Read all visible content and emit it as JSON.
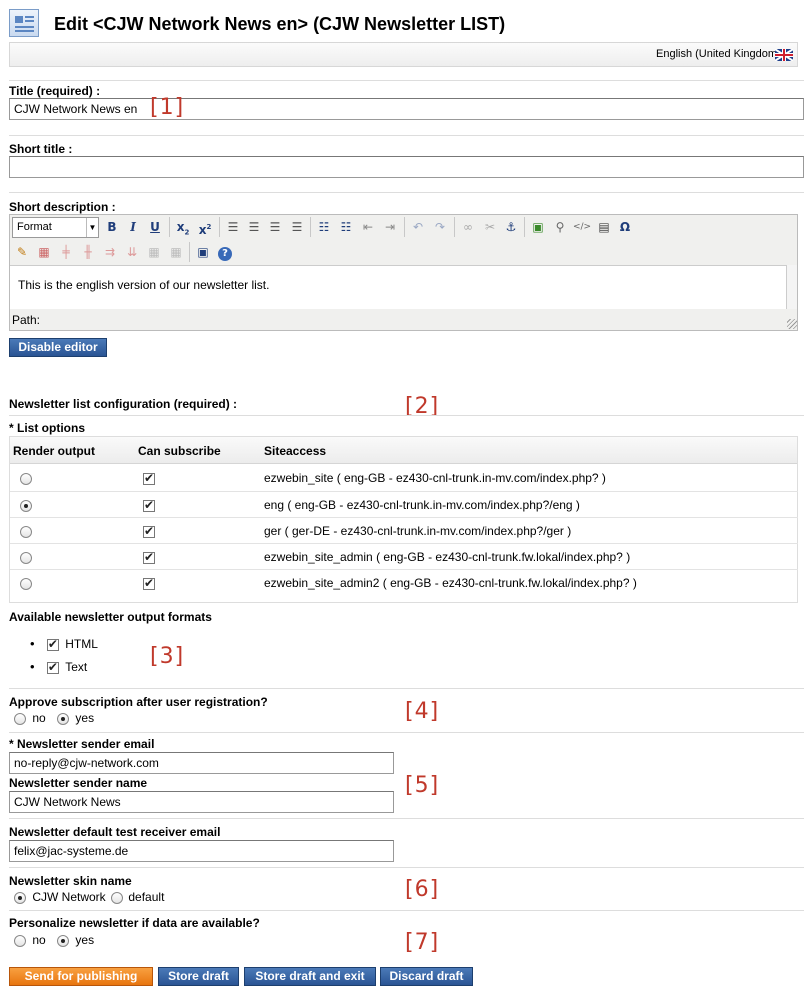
{
  "header": {
    "title": "Edit <CJW Network News en> (CJW Newsletter LIST)",
    "language": "English (United Kingdom)",
    "flag_icon": "uk-flag-icon"
  },
  "title_field": {
    "label": "Title (required) :",
    "value": "CJW Network News en"
  },
  "short_title": {
    "label": "Short title :",
    "value": ""
  },
  "short_description": {
    "label": "Short description :",
    "format_select": "Format",
    "content": "This is the english version of our newsletter list.",
    "path_label": "Path:",
    "disable_editor": "Disable editor"
  },
  "list_config": {
    "label": "Newsletter list configuration (required) :",
    "options_label": "* List options",
    "columns": [
      "Render output",
      "Can subscribe",
      "Siteaccess"
    ],
    "rows": [
      {
        "render": false,
        "subscribe": true,
        "siteaccess": "ezwebin_site ( eng-GB - ez430-cnl-trunk.in-mv.com/index.php? )"
      },
      {
        "render": true,
        "subscribe": true,
        "siteaccess": "eng ( eng-GB - ez430-cnl-trunk.in-mv.com/index.php?/eng )"
      },
      {
        "render": false,
        "subscribe": true,
        "siteaccess": "ger ( ger-DE - ez430-cnl-trunk.in-mv.com/index.php?/ger )"
      },
      {
        "render": false,
        "subscribe": true,
        "siteaccess": "ezwebin_site_admin ( eng-GB - ez430-cnl-trunk.fw.lokal/index.php? )"
      },
      {
        "render": false,
        "subscribe": true,
        "siteaccess": "ezwebin_site_admin2 ( eng-GB - ez430-cnl-trunk.fw.lokal/index.php? )"
      }
    ]
  },
  "output_formats": {
    "label": "Available newsletter output formats",
    "items": [
      "HTML",
      "Text"
    ]
  },
  "approve": {
    "label": "Approve subscription after user registration?",
    "no": "no",
    "yes": "yes",
    "selected": "yes"
  },
  "sender_email": {
    "label": "* Newsletter sender email",
    "value": "no-reply@cjw-network.com"
  },
  "sender_name": {
    "label": "Newsletter sender name",
    "value": "CJW Network News"
  },
  "test_receiver": {
    "label": "Newsletter default test receiver email",
    "value": "felix@jac-systeme.de"
  },
  "skin": {
    "label": "Newsletter skin name",
    "opt1": "CJW Network",
    "opt2": "default",
    "selected": "CJW Network"
  },
  "personalize": {
    "label": "Personalize newsletter if data are available?",
    "no": "no",
    "yes": "yes",
    "selected": "yes"
  },
  "actions": {
    "publish": "Send for publishing",
    "store": "Store draft",
    "store_exit": "Store draft and exit",
    "discard": "Discard draft"
  },
  "annotations": [
    "[1]",
    "[2]",
    "[3]",
    "[4]",
    "[5]",
    "[6]",
    "[7]"
  ],
  "colors": {
    "accent_orange": "#e8750f",
    "button_blue": "#2a5494",
    "annotation_red": "#c0392b"
  }
}
